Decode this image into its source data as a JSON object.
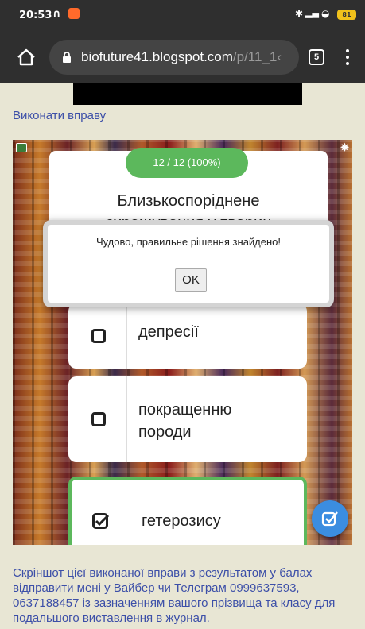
{
  "status_bar": {
    "time": "20:53",
    "battery": "81",
    "icons": [
      "headset-icon",
      "app-notification-icon",
      "bluetooth-icon",
      "signal-icon",
      "wifi-icon",
      "battery-icon"
    ]
  },
  "browser": {
    "url_domain": "biofuture41.blogspot.com",
    "url_path": "/p/11_1‹",
    "tab_count": "5"
  },
  "page": {
    "exercise_link": "Виконати вправу",
    "footer_text": "Скріншот цієї виконаної вправи з результатом у балах відправити мені у Вайбер чи Телеграм   0999637593, 0637188457 із зазначенням вашого прізвища та класу для подальшого виставлення в журнал."
  },
  "exercise": {
    "progress": "12 / 12 (100%)",
    "question_line1": "Близькоспоріднене",
    "question_line2": "схрещування у тварин",
    "answers": [
      {
        "label": "депресії",
        "checked": false
      },
      {
        "label_line1": "покращенню",
        "label_line2": "породи",
        "checked": false
      },
      {
        "label": "гетерозису",
        "checked": true
      }
    ],
    "accent_color": "#5cb85c",
    "fab_color": "#3b8de0"
  },
  "alert": {
    "message": "Чудово, правильне рішення знайдено!",
    "ok_label": "OK"
  }
}
